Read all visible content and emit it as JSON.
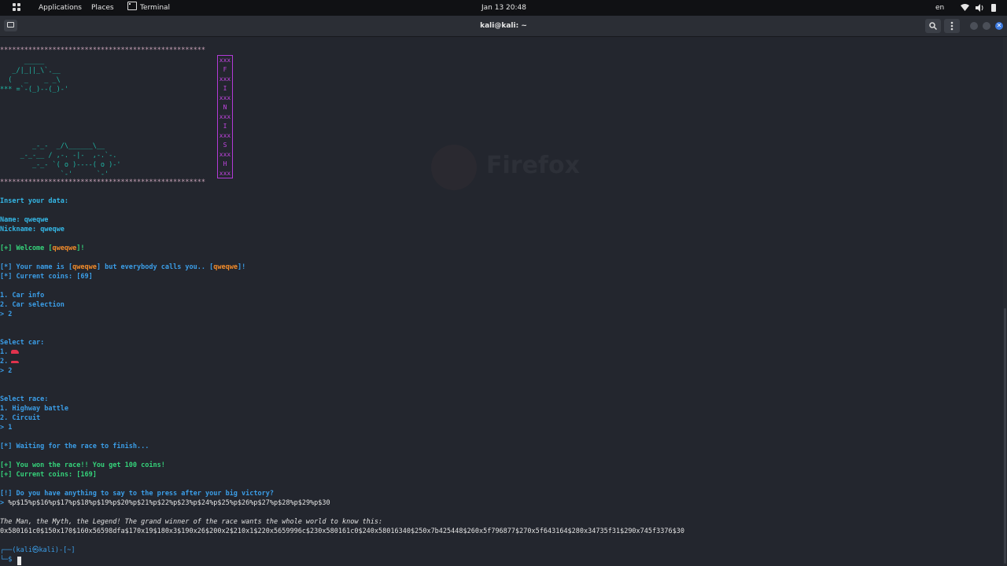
{
  "topbar": {
    "applications": "Applications",
    "places": "Places",
    "terminal": "Terminal",
    "datetime": "Jan 13  20:48",
    "lang": "en"
  },
  "window": {
    "title": "kali@kali: ~"
  },
  "background": {
    "ghost_text": "Firefox"
  },
  "terminal": {
    "stars": "***************************************************",
    "car1": [
      "      _____",
      "   _/|_||_\\`.__",
      "  (   _    _ _\\",
      "*** =`-(_)--(_)-'"
    ],
    "car2": [
      "        _-_-  _/\\______\\__",
      "     _-_-__ / ,-. -|-  ,-.`-.",
      "        _-_- `( o )----( o )-'",
      "               `-'      `-'"
    ],
    "finish_box": [
      "xxx",
      "F",
      "xxx",
      "I",
      "xxx",
      "N",
      "xxx",
      "I",
      "xxx",
      "S",
      "xxx",
      "H",
      "xxx"
    ],
    "insert": "Insert your data:",
    "name_label": "Name: ",
    "name_val": "qweqwe",
    "nick_label": "Nickname: ",
    "nick_val": "qweqwe",
    "welcome_a": "[+] Welcome [",
    "welcome_name": "qweqwe",
    "welcome_b": "]!",
    "yourname_a": "[*] Your name is [",
    "yourname_n": "qweqwe",
    "yourname_b": "] but everybody calls you.. [",
    "yourname_nick": "qweqwe",
    "yourname_c": "]!",
    "coins1": "[*] Current coins: [69]",
    "menu1": "1. Car info",
    "menu2": "2. Car selection",
    "choice1": "> 2",
    "select_car": "Select car:",
    "car_opt1": "1.",
    "car_opt2": "2.",
    "choice2": "> 2",
    "select_race": "Select race:",
    "race1": "1. Highway battle",
    "race2": "2. Circuit",
    "choice3": "> 1",
    "waiting": "[*] Waiting for the race to finish...",
    "won": "[+] You won the race!! You get 100 coins!",
    "coins2": "[+] Current coins: [169]",
    "press_q": "[!] Do you have anything to say to the press after your big victory?",
    "press_prompt": "> ",
    "press_input": "%p$15%p$16%p$17%p$18%p$19%p$20%p$21%p$22%p$23%p$24%p$25%p$26%p$27%p$28%p$29%p$30",
    "man_myth": "The Man, the Myth, the Legend! The grand winner of the race wants the whole world to know this:",
    "leak": "0x580161c0$150x170$160x56598dfa$170x19$180x3$190x26$200x2$210x1$220x5659996c$230x580161c0$240x58016340$250x7b425448$260x5f796877$270x5f643164$280x34735f31$290x745f3376$30",
    "prompt_line1": "┌──(kali㉿kali)-[~]",
    "prompt_line2": "└─$ "
  },
  "colors": {
    "accent_blue": "#3b9ee8",
    "green": "#35d27a",
    "orange": "#f08a2a",
    "magenta": "#c045e0",
    "close_button": "#3d7be0"
  },
  "icons": [
    "apps-grid-icon",
    "terminal-icon",
    "new-tab-icon",
    "search-icon",
    "menu-icon",
    "wifi-icon",
    "volume-icon",
    "battery-icon",
    "close-icon",
    "car-icon"
  ]
}
